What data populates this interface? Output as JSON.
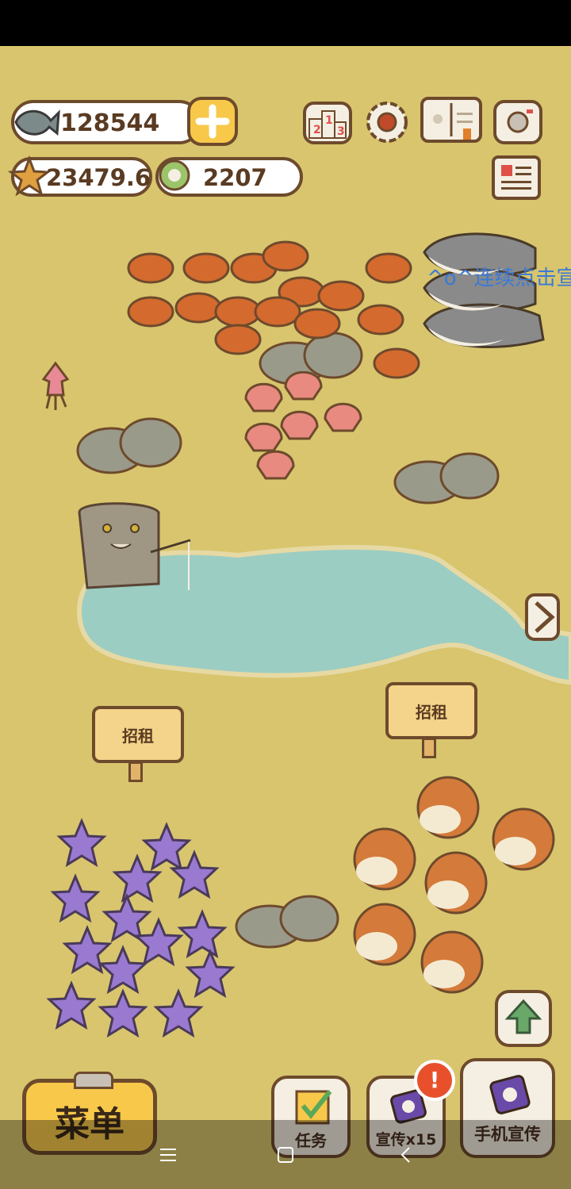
{
  "hud": {
    "fish_count": "128544",
    "starfish_count": "23479.6",
    "coin_count": "2207"
  },
  "overlay": {
    "tap_hint": "^o^连续点击宣"
  },
  "signs": [
    {
      "label": "招租"
    },
    {
      "label": "招租"
    }
  ],
  "buttons": {
    "menu": "菜单",
    "tasks": "任务",
    "promote": "宣传x15",
    "phone_promote": "手机宣传"
  },
  "badges": {
    "promote_alert": "!"
  },
  "colors": {
    "ground": "#d8c56e",
    "pond": "#9ccdc2",
    "outline": "#6e4a2c",
    "crab": "#d46a2e",
    "starfish": "#9a7ad0",
    "pufferfish": "#d47a3a",
    "scallop": "#e88a80",
    "shark": "#8a8a8a",
    "alert": "#e8502c"
  }
}
